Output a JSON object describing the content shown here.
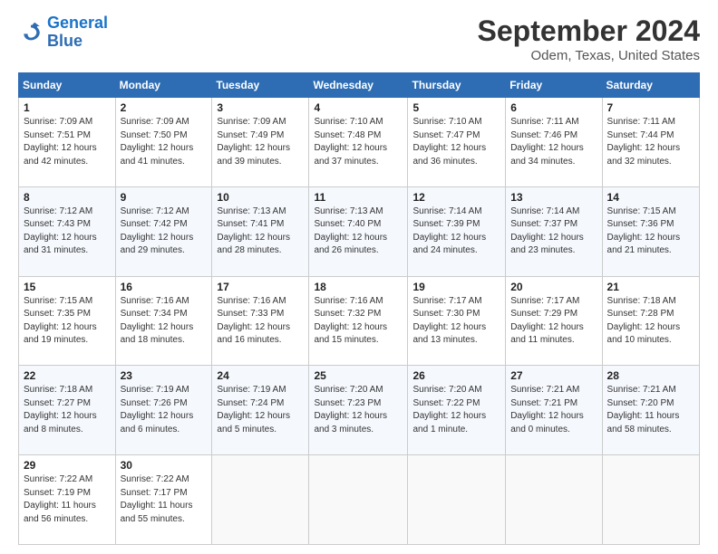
{
  "logo": {
    "line1": "General",
    "line2": "Blue"
  },
  "header": {
    "month": "September 2024",
    "location": "Odem, Texas, United States"
  },
  "weekdays": [
    "Sunday",
    "Monday",
    "Tuesday",
    "Wednesday",
    "Thursday",
    "Friday",
    "Saturday"
  ],
  "weeks": [
    [
      {
        "day": "1",
        "info": "Sunrise: 7:09 AM\nSunset: 7:51 PM\nDaylight: 12 hours\nand 42 minutes."
      },
      {
        "day": "2",
        "info": "Sunrise: 7:09 AM\nSunset: 7:50 PM\nDaylight: 12 hours\nand 41 minutes."
      },
      {
        "day": "3",
        "info": "Sunrise: 7:09 AM\nSunset: 7:49 PM\nDaylight: 12 hours\nand 39 minutes."
      },
      {
        "day": "4",
        "info": "Sunrise: 7:10 AM\nSunset: 7:48 PM\nDaylight: 12 hours\nand 37 minutes."
      },
      {
        "day": "5",
        "info": "Sunrise: 7:10 AM\nSunset: 7:47 PM\nDaylight: 12 hours\nand 36 minutes."
      },
      {
        "day": "6",
        "info": "Sunrise: 7:11 AM\nSunset: 7:46 PM\nDaylight: 12 hours\nand 34 minutes."
      },
      {
        "day": "7",
        "info": "Sunrise: 7:11 AM\nSunset: 7:44 PM\nDaylight: 12 hours\nand 32 minutes."
      }
    ],
    [
      {
        "day": "8",
        "info": "Sunrise: 7:12 AM\nSunset: 7:43 PM\nDaylight: 12 hours\nand 31 minutes."
      },
      {
        "day": "9",
        "info": "Sunrise: 7:12 AM\nSunset: 7:42 PM\nDaylight: 12 hours\nand 29 minutes."
      },
      {
        "day": "10",
        "info": "Sunrise: 7:13 AM\nSunset: 7:41 PM\nDaylight: 12 hours\nand 28 minutes."
      },
      {
        "day": "11",
        "info": "Sunrise: 7:13 AM\nSunset: 7:40 PM\nDaylight: 12 hours\nand 26 minutes."
      },
      {
        "day": "12",
        "info": "Sunrise: 7:14 AM\nSunset: 7:39 PM\nDaylight: 12 hours\nand 24 minutes."
      },
      {
        "day": "13",
        "info": "Sunrise: 7:14 AM\nSunset: 7:37 PM\nDaylight: 12 hours\nand 23 minutes."
      },
      {
        "day": "14",
        "info": "Sunrise: 7:15 AM\nSunset: 7:36 PM\nDaylight: 12 hours\nand 21 minutes."
      }
    ],
    [
      {
        "day": "15",
        "info": "Sunrise: 7:15 AM\nSunset: 7:35 PM\nDaylight: 12 hours\nand 19 minutes."
      },
      {
        "day": "16",
        "info": "Sunrise: 7:16 AM\nSunset: 7:34 PM\nDaylight: 12 hours\nand 18 minutes."
      },
      {
        "day": "17",
        "info": "Sunrise: 7:16 AM\nSunset: 7:33 PM\nDaylight: 12 hours\nand 16 minutes."
      },
      {
        "day": "18",
        "info": "Sunrise: 7:16 AM\nSunset: 7:32 PM\nDaylight: 12 hours\nand 15 minutes."
      },
      {
        "day": "19",
        "info": "Sunrise: 7:17 AM\nSunset: 7:30 PM\nDaylight: 12 hours\nand 13 minutes."
      },
      {
        "day": "20",
        "info": "Sunrise: 7:17 AM\nSunset: 7:29 PM\nDaylight: 12 hours\nand 11 minutes."
      },
      {
        "day": "21",
        "info": "Sunrise: 7:18 AM\nSunset: 7:28 PM\nDaylight: 12 hours\nand 10 minutes."
      }
    ],
    [
      {
        "day": "22",
        "info": "Sunrise: 7:18 AM\nSunset: 7:27 PM\nDaylight: 12 hours\nand 8 minutes."
      },
      {
        "day": "23",
        "info": "Sunrise: 7:19 AM\nSunset: 7:26 PM\nDaylight: 12 hours\nand 6 minutes."
      },
      {
        "day": "24",
        "info": "Sunrise: 7:19 AM\nSunset: 7:24 PM\nDaylight: 12 hours\nand 5 minutes."
      },
      {
        "day": "25",
        "info": "Sunrise: 7:20 AM\nSunset: 7:23 PM\nDaylight: 12 hours\nand 3 minutes."
      },
      {
        "day": "26",
        "info": "Sunrise: 7:20 AM\nSunset: 7:22 PM\nDaylight: 12 hours\nand 1 minute."
      },
      {
        "day": "27",
        "info": "Sunrise: 7:21 AM\nSunset: 7:21 PM\nDaylight: 12 hours\nand 0 minutes."
      },
      {
        "day": "28",
        "info": "Sunrise: 7:21 AM\nSunset: 7:20 PM\nDaylight: 11 hours\nand 58 minutes."
      }
    ],
    [
      {
        "day": "29",
        "info": "Sunrise: 7:22 AM\nSunset: 7:19 PM\nDaylight: 11 hours\nand 56 minutes."
      },
      {
        "day": "30",
        "info": "Sunrise: 7:22 AM\nSunset: 7:17 PM\nDaylight: 11 hours\nand 55 minutes."
      },
      null,
      null,
      null,
      null,
      null
    ]
  ]
}
